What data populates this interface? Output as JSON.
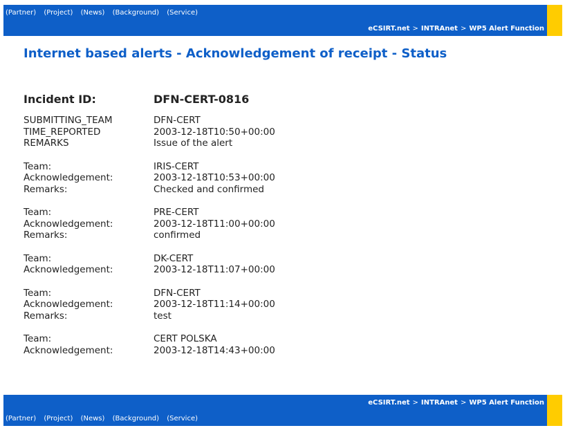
{
  "nav": {
    "items": [
      "(Partner)",
      "(Project)",
      "(News)",
      "(Background)",
      "(Service)"
    ]
  },
  "breadcrumb": {
    "items": [
      "eCSIRT.net",
      "INTRAnet",
      "WP5 Alert Function"
    ],
    "separator": ">"
  },
  "page": {
    "title": "Internet based alerts - Acknowledgement of receipt - Status"
  },
  "incident": {
    "label": "Incident ID:",
    "value": "DFN-CERT-0816"
  },
  "summary": [
    {
      "key": "SUBMITTING_TEAM",
      "value": "DFN-CERT"
    },
    {
      "key": "TIME_REPORTED",
      "value": "2003-12-18T10:50+00:00"
    },
    {
      "key": "REMARKS",
      "value": "Issue of the alert"
    }
  ],
  "labels": {
    "team": "Team:",
    "ack": "Acknowledgement:",
    "remarks": "Remarks:"
  },
  "acks": [
    {
      "team": "IRIS-CERT",
      "ack": "2003-12-18T10:53+00:00",
      "remarks": "Checked and confirmed"
    },
    {
      "team": "PRE-CERT",
      "ack": "2003-12-18T11:00+00:00",
      "remarks": "confirmed"
    },
    {
      "team": "DK-CERT",
      "ack": "2003-12-18T11:07+00:00"
    },
    {
      "team": "DFN-CERT",
      "ack": "2003-12-18T11:14+00:00",
      "remarks": "test"
    },
    {
      "team": "CERT POLSKA",
      "ack": "2003-12-18T14:43+00:00"
    }
  ],
  "colors": {
    "bar": "#0e5fc8",
    "accent": "#ffcc00",
    "title": "#0e5fc8"
  }
}
